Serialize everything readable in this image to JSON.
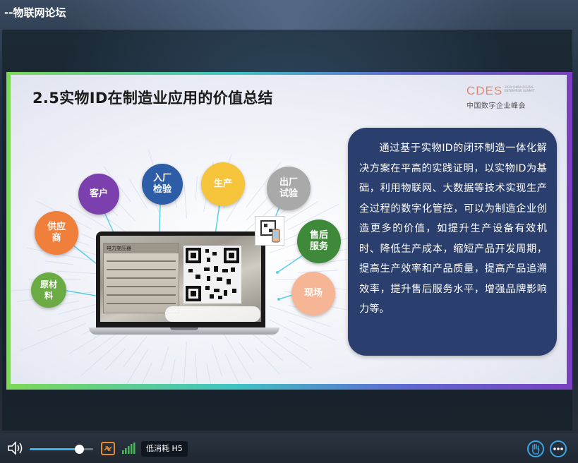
{
  "app": {
    "title": "--物联网论坛"
  },
  "slide": {
    "title": "2.5实物ID在制造业应用的价值总结",
    "logo": {
      "brand": "CDES",
      "small_text": "2020 CHINA DIGITAL ENTERPRISE SUMMIT",
      "subtitle": "中国数字企业峰会"
    },
    "nodes": [
      {
        "label": "原材\n料",
        "color": "#6aac43"
      },
      {
        "label": "供应\n商",
        "color": "#f07f3c"
      },
      {
        "label": "客户",
        "color": "#7b3fae"
      },
      {
        "label": "入厂\n检验",
        "color": "#2e5da7"
      },
      {
        "label": "生产",
        "color": "#f5c43a"
      },
      {
        "label": "出厂\n试验",
        "color": "#a9a9a9"
      },
      {
        "label": "售后\n服务",
        "color": "#3f8a3a"
      },
      {
        "label": "现场",
        "color": "#f6b594"
      }
    ],
    "laptop": {
      "nameplate_title": "电力变压器"
    },
    "panel_text": "通过基于实物ID的闭环制造一体化解决方案在平高的实践证明，以实物ID为基础，利用物联网、大数据等技术实现生产全过程的数字化管控，可以为制造企业创造更多的价值，如提升生产设备有效机时、降低生产成本，缩短产品开发周期，提高生产效率和产品质量，提高产品追溯效率，提升售后服务水平，增强品牌影响力等。",
    "panel_color": "#2b3f6e"
  },
  "controls": {
    "volume_percent": 78,
    "mode_label": "低消耗 H5",
    "accent": "#3ab4f2",
    "fullscreen_color": "#e98a2c",
    "signal_color": "#3cc24a"
  }
}
